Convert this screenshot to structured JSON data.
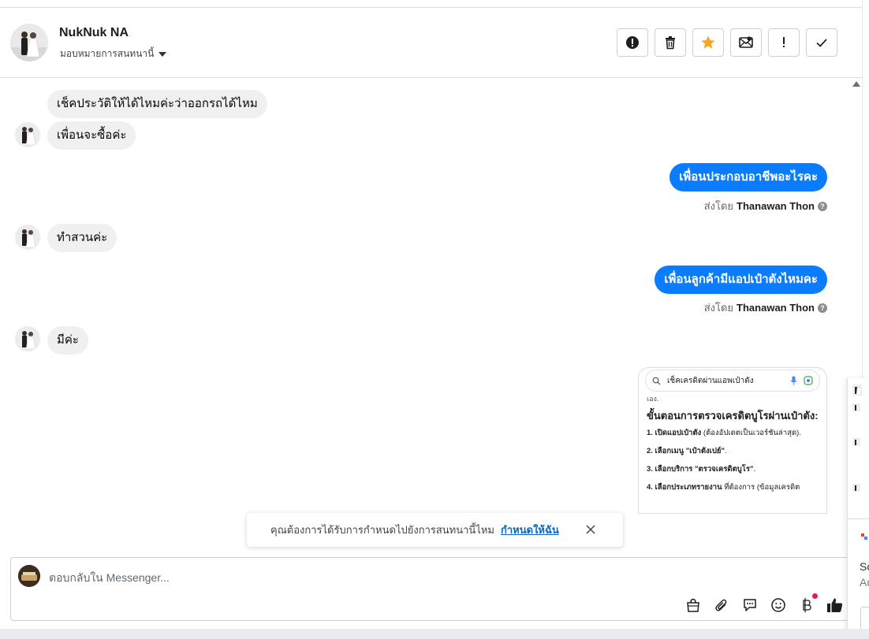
{
  "header": {
    "name": "NukNuk NA",
    "assign_label": "มอบหมายการสนทนานี้"
  },
  "messages": [
    {
      "text": "เช็คประวัติให้ได้ไหมค่ะว่าออกรถได้ไหม"
    },
    {
      "text": "เพื่อนจะซื้อค่ะ"
    },
    {
      "text": "เพื่อนประกอบอาชีพอะไรคะ",
      "sent_by_prefix": "ส่งโดย",
      "sent_by_name": "Thanawan Thon"
    },
    {
      "text": "ทำสวนค่ะ"
    },
    {
      "text": "เพื่อนลูกค้ามีแอปเป๋าตังไหมคะ",
      "sent_by_prefix": "ส่งโดย",
      "sent_by_name": "Thanawan Thon"
    },
    {
      "text": "มีค่ะ"
    }
  ],
  "screenshot_attachment": {
    "search_query": "เช็คเครดิตผ่านแอพเป๋าตัง",
    "fragment": "เอง.",
    "title": "ขั้นตอนการตรวจเครดิตบูโรผ่านเป๋าตัง:",
    "steps": [
      {
        "bold": "1. เปิดแอปเป๋าตัง",
        "rest": " (ต้องอัปเดตเป็นเวอร์ชันล่าสุด)."
      },
      {
        "bold": "2. เลือกเมนู \"เป๋าตังเปย์\"",
        "rest": "."
      },
      {
        "bold": "3. เลือกบริการ \"ตรวจเครดิตบูโร\"",
        "rest": "."
      },
      {
        "bold": "4. เลือกประเภทรายงาน",
        "rest": " ที่ต้องการ (ข้อมูลเครดิต"
      }
    ]
  },
  "toast": {
    "text": "คุณต้องการได้รับการกำหนดไปยังการสนทนานี้ไหม",
    "link": "กำหนดให้ฉัน"
  },
  "composer": {
    "placeholder": "ตอบกลับใน Messenger..."
  },
  "side_panel": {
    "text_1": "Sc",
    "text_2": "Au"
  },
  "colors": {
    "outgoing_bubble": "#0a7cff",
    "incoming_bubble": "#f0f0f0",
    "star": "#f5a623",
    "link": "#0a66c2"
  }
}
